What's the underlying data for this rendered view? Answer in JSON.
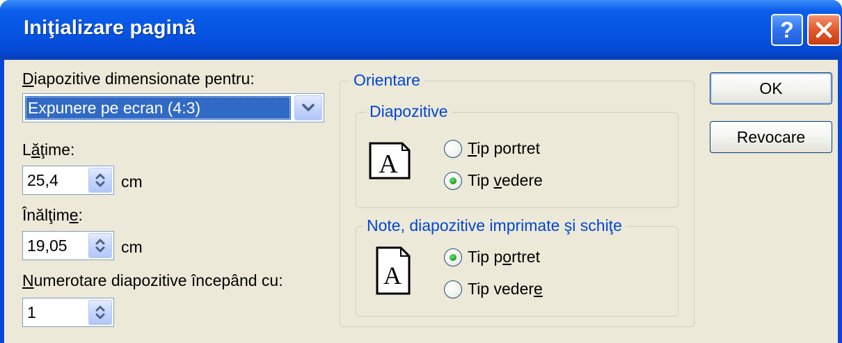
{
  "window": {
    "title": "Iniţializare pagină"
  },
  "titlebar_buttons": {
    "help_glyph": "?",
    "close_icon": "close-icon"
  },
  "slide_size": {
    "label_first": "D",
    "label_rest": "iapozitive dimensionate pentru:",
    "selected": "Expunere pe ecran (4:3)"
  },
  "width": {
    "label_pre": "L",
    "label_ul": "ă",
    "label_post": "ţime:",
    "value": "25,4",
    "unit": "cm"
  },
  "height": {
    "label_pre": "Înălţim",
    "label_ul": "e",
    "label_post": ":",
    "value": "19,05",
    "unit": "cm"
  },
  "numbering": {
    "label_first": "N",
    "label_rest": "umerotare diapozitive începând cu:",
    "value": "1"
  },
  "orientation": {
    "legend": "Orientare",
    "slides": {
      "legend": "Diapozitive",
      "portrait_ul": "T",
      "portrait_rest": "ip portret",
      "landscape_pre": "Tip ",
      "landscape_ul": "v",
      "landscape_post": "edere",
      "selected": "landscape"
    },
    "notes": {
      "legend": "Note, diapozitive imprimate şi schiţe",
      "portrait_pre": "Tip p",
      "portrait_ul": "o",
      "portrait_post": "rtret",
      "landscape_pre": "Tip veder",
      "landscape_ul": "e",
      "landscape_post": "",
      "selected": "portrait"
    },
    "page_glyph": "A"
  },
  "buttons": {
    "ok": "OK",
    "cancel": "Revocare"
  },
  "colors": {
    "titlebar": "#0654e3",
    "client_bg": "#ece9d8",
    "group_legend": "#0046d5",
    "selection": "#316ac5",
    "radio_dot": "#2aa531",
    "close_button": "#e05a2c"
  }
}
